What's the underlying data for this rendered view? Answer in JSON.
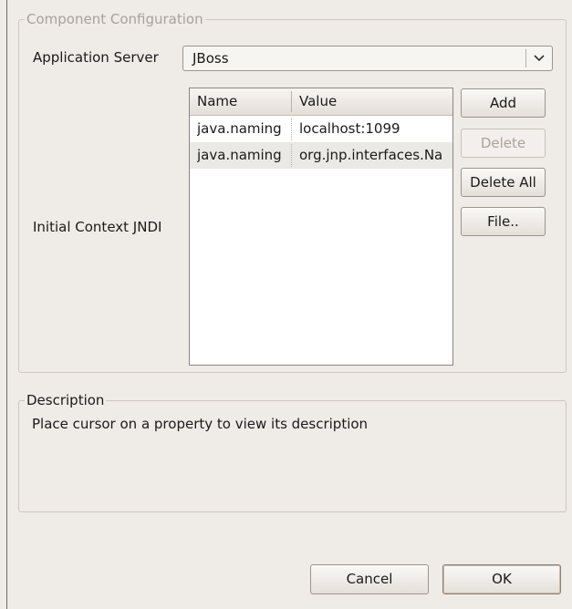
{
  "config_group": {
    "title": "Component Configuration"
  },
  "app_server": {
    "label": "Application Server",
    "selected": "JBoss"
  },
  "jndi": {
    "label": "Initial Context JNDI",
    "columns": [
      "Name",
      "Value"
    ],
    "rows": [
      {
        "name": "java.naming",
        "value": "localhost:1099"
      },
      {
        "name": "java.naming",
        "value": "org.jnp.interfaces.Na"
      }
    ],
    "buttons": {
      "add": "Add",
      "delete": "Delete",
      "delete_all": "Delete All",
      "file": "File.."
    }
  },
  "description_group": {
    "title": "Description",
    "text": "Place cursor on a property to view its description"
  },
  "dialog_buttons": {
    "cancel": "Cancel",
    "ok": "OK"
  }
}
